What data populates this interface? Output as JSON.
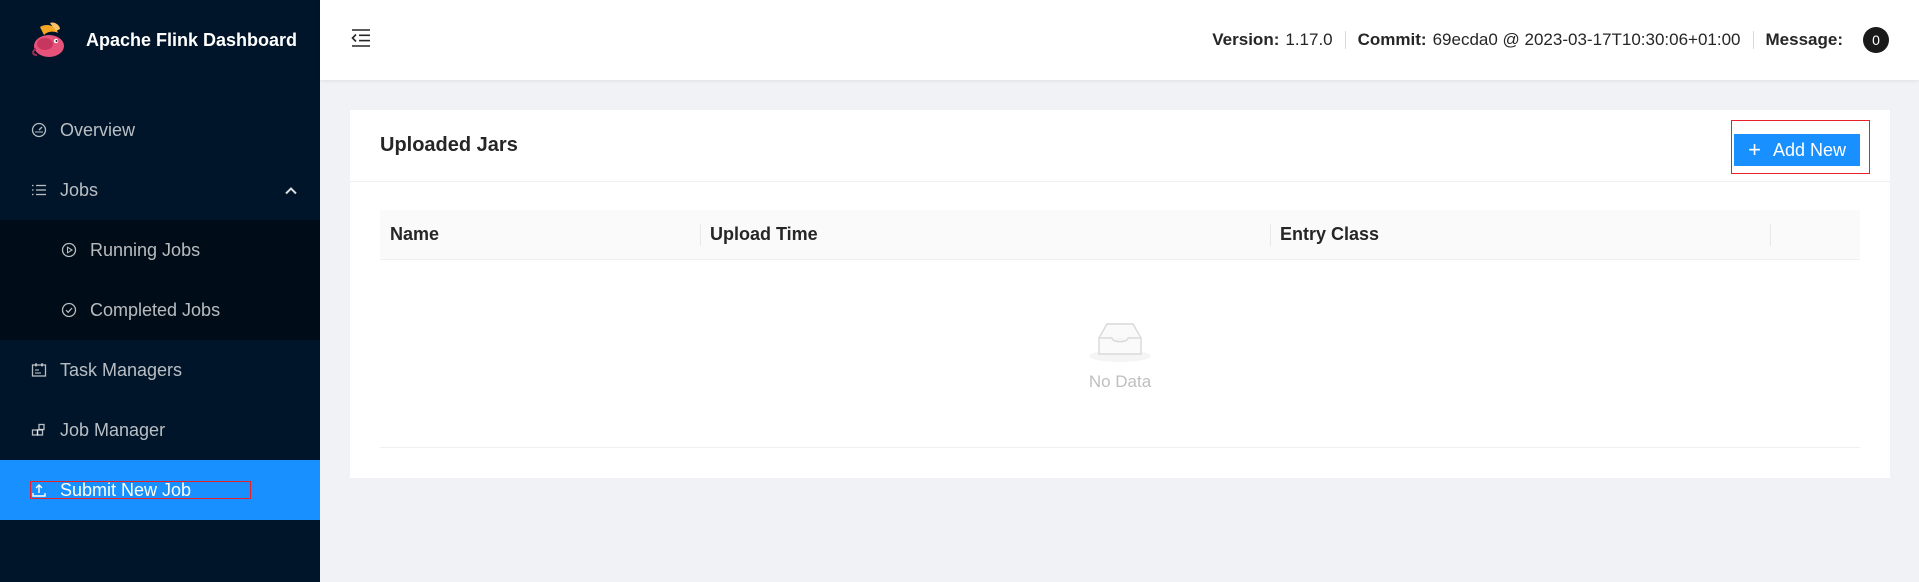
{
  "brand": {
    "title": "Apache Flink Dashboard"
  },
  "sidebar": {
    "items": [
      {
        "label": "Overview",
        "icon": "dashboard-icon"
      },
      {
        "label": "Jobs",
        "icon": "list-icon",
        "expanded": true,
        "children": [
          {
            "label": "Running Jobs",
            "icon": "play-circle-icon"
          },
          {
            "label": "Completed Jobs",
            "icon": "check-circle-icon"
          }
        ]
      },
      {
        "label": "Task Managers",
        "icon": "schedule-icon"
      },
      {
        "label": "Job Manager",
        "icon": "build-icon"
      },
      {
        "label": "Submit New Job",
        "icon": "upload-icon",
        "active": true
      }
    ]
  },
  "header": {
    "version_label": "Version:",
    "version_value": "1.17.0",
    "commit_label": "Commit:",
    "commit_value": "69ecda0 @ 2023-03-17T10:30:06+01:00",
    "message_label": "Message:",
    "message_count": "0"
  },
  "main": {
    "card_title": "Uploaded Jars",
    "add_button_label": "Add New",
    "table": {
      "columns": [
        "Name",
        "Upload Time",
        "Entry Class",
        ""
      ],
      "rows": [],
      "empty_text": "No Data"
    }
  },
  "colors": {
    "sidebar_bg": "#001529",
    "accent": "#1890ff",
    "highlight": "#e8202a"
  }
}
